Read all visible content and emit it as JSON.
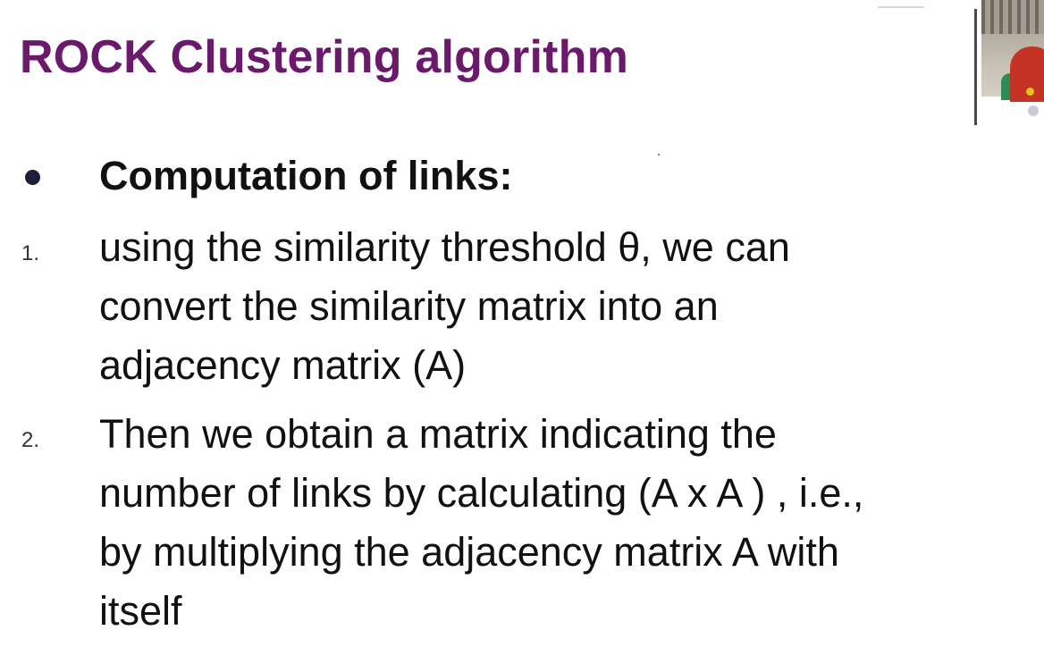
{
  "slide": {
    "title": "ROCK Clustering algorithm",
    "title_color": "#6b1a6b",
    "bullet": {
      "text": "Computation of links:"
    },
    "items": [
      {
        "number": "1.",
        "text": "using the similarity threshold θ, we can\nconvert the similarity matrix into an\nadjacency matrix (A)"
      },
      {
        "number": "2.",
        "text": "Then we obtain a matrix indicating the\nnumber of links by calculating (A x A ) , i.e.,\nby multiplying the adjacency matrix A with\nitself"
      }
    ]
  },
  "colors": {
    "text": "#111111",
    "bullet_dot": "#1e1e3c",
    "background": "#ffffff"
  }
}
